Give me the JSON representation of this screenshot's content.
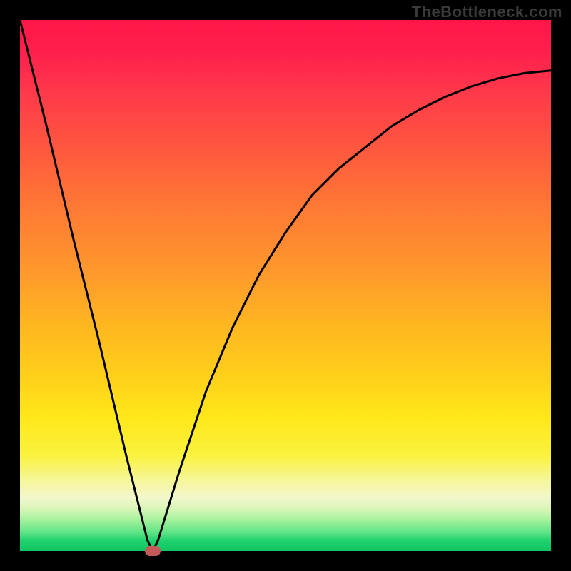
{
  "watermark": "TheBottleneck.com",
  "chart_data": {
    "type": "line",
    "title": "",
    "xlabel": "",
    "ylabel": "",
    "xlim": [
      0,
      100
    ],
    "ylim": [
      0,
      100
    ],
    "grid": false,
    "legend": false,
    "series": [
      {
        "name": "bottleneck-curve",
        "x": [
          0,
          5,
          10,
          15,
          20,
          24,
          25,
          26,
          30,
          35,
          40,
          45,
          50,
          55,
          60,
          65,
          70,
          75,
          80,
          85,
          90,
          95,
          100
        ],
        "y": [
          100,
          80,
          59,
          39,
          18,
          2,
          0,
          2,
          15,
          30,
          42,
          52,
          60,
          67,
          72,
          76,
          80,
          83,
          85.5,
          87.5,
          89,
          90,
          90.5
        ]
      }
    ],
    "annotations": [
      {
        "name": "minima-marker",
        "x": 25,
        "y": 0,
        "color": "#c25a5a"
      }
    ],
    "background_gradient_stops": [
      {
        "pct": 0,
        "color": "#ff1648"
      },
      {
        "pct": 25,
        "color": "#ff5a3e"
      },
      {
        "pct": 50,
        "color": "#ffb81f"
      },
      {
        "pct": 75,
        "color": "#ffe81a"
      },
      {
        "pct": 92,
        "color": "#d9f6b8"
      },
      {
        "pct": 100,
        "color": "#11c564"
      }
    ]
  }
}
